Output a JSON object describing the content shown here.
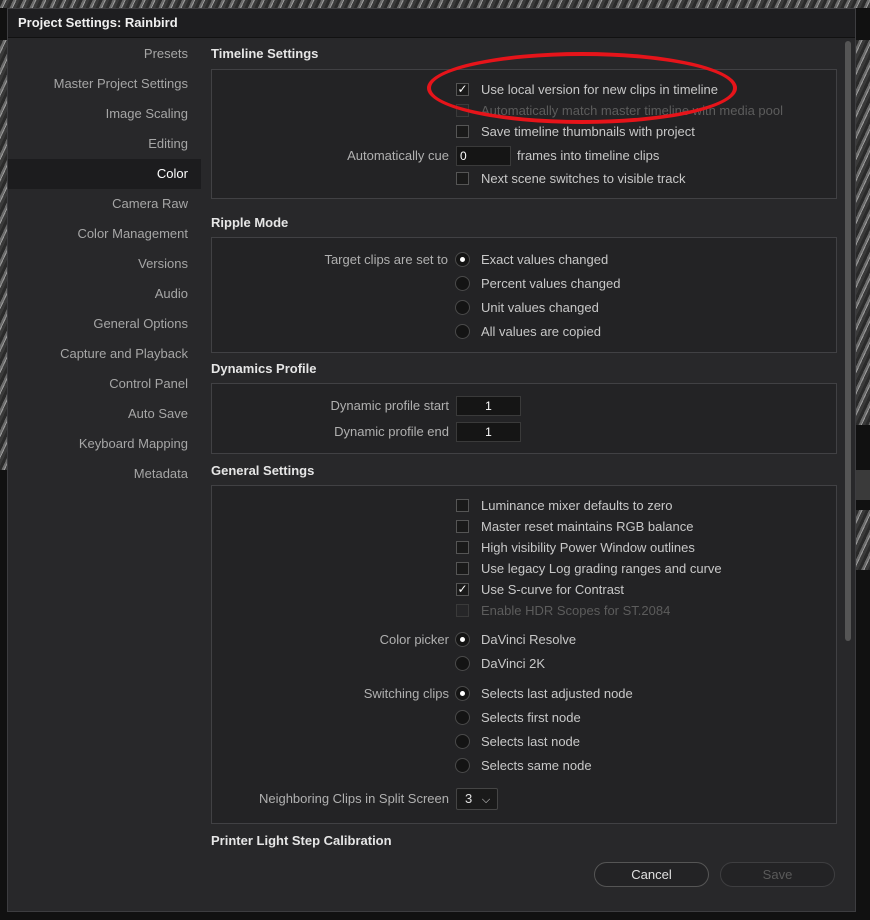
{
  "dialog": {
    "title": "Project Settings:  Rainbird"
  },
  "sidebar": {
    "items": [
      {
        "label": "Presets",
        "active": false
      },
      {
        "label": "Master Project Settings",
        "active": false
      },
      {
        "label": "Image Scaling",
        "active": false
      },
      {
        "label": "Editing",
        "active": false
      },
      {
        "label": "Color",
        "active": true
      },
      {
        "label": "Camera Raw",
        "active": false
      },
      {
        "label": "Color Management",
        "active": false
      },
      {
        "label": "Versions",
        "active": false
      },
      {
        "label": "Audio",
        "active": false
      },
      {
        "label": "General Options",
        "active": false
      },
      {
        "label": "Capture and Playback",
        "active": false
      },
      {
        "label": "Control Panel",
        "active": false
      },
      {
        "label": "Auto Save",
        "active": false
      },
      {
        "label": "Keyboard Mapping",
        "active": false
      },
      {
        "label": "Metadata",
        "active": false
      }
    ]
  },
  "timeline": {
    "title": "Timeline Settings",
    "use_local": "Use local version for new clips in timeline",
    "auto_match": "Automatically match master timeline with media pool",
    "save_thumbs": "Save timeline thumbnails with project",
    "auto_cue_label": "Automatically cue",
    "auto_cue_value": "0",
    "auto_cue_suffix": "frames into timeline clips",
    "next_scene": "Next scene switches to visible track"
  },
  "ripple": {
    "title": "Ripple Mode",
    "label": "Target clips are set to",
    "options": [
      "Exact values changed",
      "Percent values changed",
      "Unit values changed",
      "All values are copied"
    ]
  },
  "dynamics": {
    "title": "Dynamics Profile",
    "start_label": "Dynamic profile start",
    "start_value": "1",
    "end_label": "Dynamic profile end",
    "end_value": "1"
  },
  "general": {
    "title": "General Settings",
    "checks": [
      {
        "label": "Luminance mixer defaults to zero"
      },
      {
        "label": "Master reset maintains RGB balance"
      },
      {
        "label": "High visibility Power Window outlines"
      },
      {
        "label": "Use legacy Log grading ranges and curve"
      },
      {
        "label": "Use S-curve for Contrast"
      },
      {
        "label": "Enable HDR Scopes for ST.2084"
      }
    ],
    "color_picker_label": "Color picker",
    "color_picker_options": [
      "DaVinci Resolve",
      "DaVinci 2K"
    ],
    "switching_label": "Switching clips",
    "switching_options": [
      "Selects last adjusted node",
      "Selects first node",
      "Selects last node",
      "Selects same node"
    ],
    "neighbor_label": "Neighboring Clips in Split Screen",
    "neighbor_value": "3"
  },
  "printer": {
    "title": "Printer Light Step Calibration"
  },
  "buttons": {
    "cancel": "Cancel",
    "save": "Save"
  },
  "icons": {
    "check": "✓",
    "chevron": "⌵"
  },
  "colors": {
    "annotation": "#e6141a"
  }
}
